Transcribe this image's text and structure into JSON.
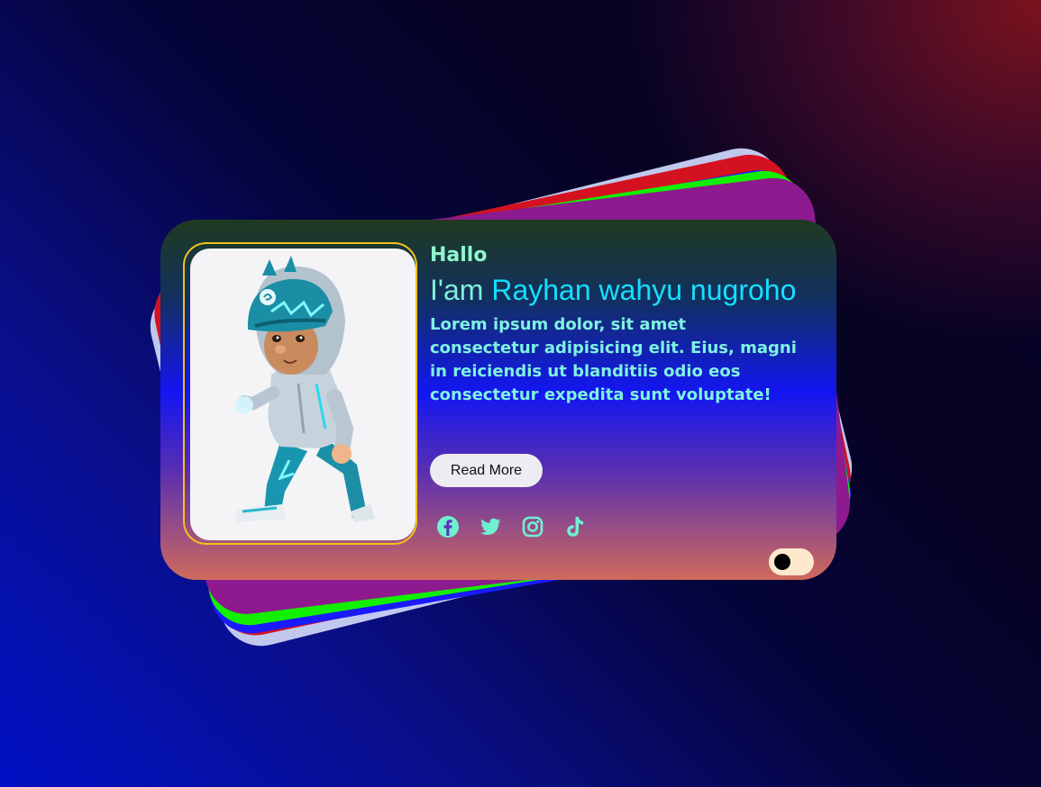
{
  "profile": {
    "greeting": "Hallo",
    "name_prefix": "I'am",
    "name": "Rayhan wahyu nugroho",
    "bio": "Lorem ipsum dolor, sit amet consectetur adipisicing elit. Eius, magni in reiciendis ut blanditiis odio eos consectetur expedita sunt voluptate!",
    "read_more_label": "Read More",
    "avatar_icon": "cartoon-character-portrait"
  },
  "socials": [
    {
      "icon": "facebook-icon"
    },
    {
      "icon": "twitter-icon"
    },
    {
      "icon": "instagram-icon"
    },
    {
      "icon": "tiktok-icon"
    }
  ],
  "theme_toggle": {
    "state": "off"
  },
  "colors": {
    "accent_cyan": "#14e0ff",
    "text_mint": "#7ef2e0",
    "frame_gold": "#f3c21a",
    "stack_colors": [
      "#c0c8ee",
      "#d4121f",
      "#1a1aff",
      "#12f000",
      "#8d1a8f"
    ]
  }
}
